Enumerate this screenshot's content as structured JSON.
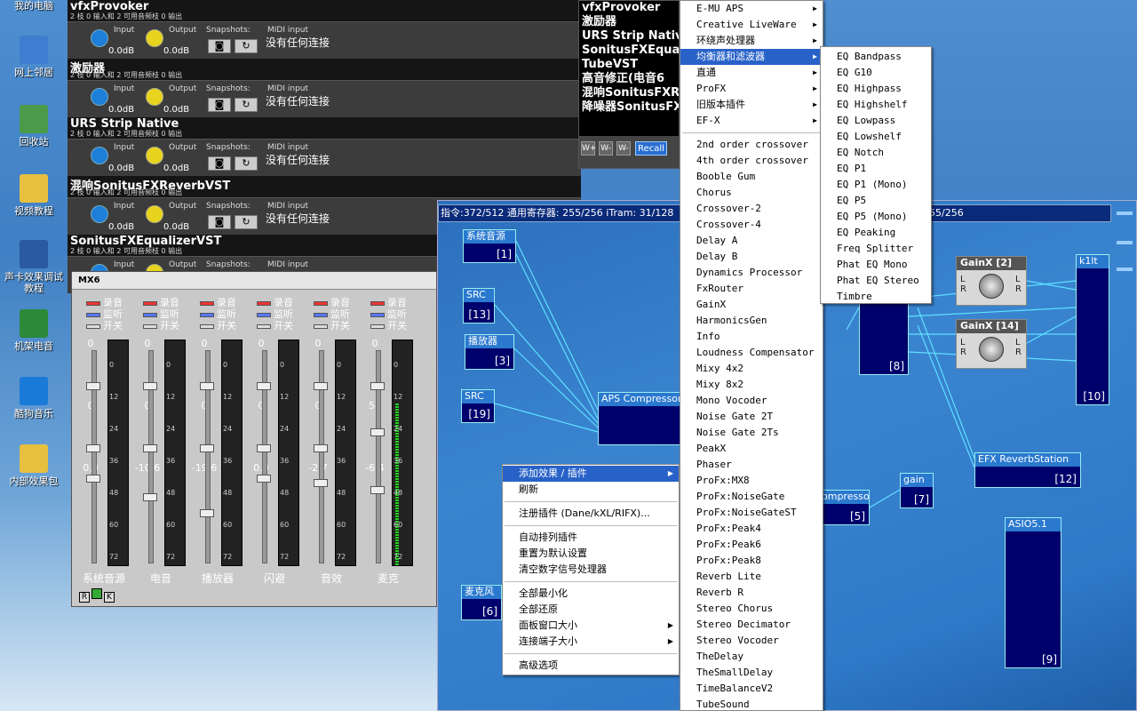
{
  "desktop": {
    "icons": [
      {
        "label": "我的电脑",
        "color": "#6a8ab5"
      },
      {
        "label": "网上邻居",
        "color": "#3e7ed0"
      },
      {
        "label": "回收站",
        "color": "#4a9a4a"
      },
      {
        "label": "视频教程",
        "color": "#e8c040"
      },
      {
        "label": "声卡效果调试教程",
        "color": "#2a5aa0"
      },
      {
        "label": "机架电音",
        "color": "#2a8a3a"
      },
      {
        "label": "酷狗音乐",
        "color": "#1a7ad8"
      },
      {
        "label": "内部效果包",
        "color": "#e8c040"
      }
    ]
  },
  "rack": {
    "plugins": [
      {
        "name": "vfxProvoker",
        "info": "2 枝 0 输入和 2 可用音频枝 0 输出",
        "input_label": "Input",
        "output_label": "Output",
        "input_val": "0.0dB",
        "output_val": "0.0dB",
        "snap_label": "Snapshots:",
        "midi_label": "MIDI input",
        "midi_status": "没有任何连接"
      },
      {
        "name": "激励器",
        "info": "2 枝 0 输入和 2 可用音频枝 0 输出",
        "input_label": "Input",
        "output_label": "Output",
        "input_val": "0.0dB",
        "output_val": "0.0dB",
        "snap_label": "Snapshots:",
        "midi_label": "MIDI input",
        "midi_status": "没有任何连接"
      },
      {
        "name": "URS Strip Native",
        "info": "2 枝 0 输入和 2 可用音频枝 0 输出",
        "input_label": "Input",
        "output_label": "Output",
        "input_val": "0.0dB",
        "output_val": "0.0dB",
        "snap_label": "Snapshots:",
        "midi_label": "MIDI input",
        "midi_status": "没有任何连接"
      },
      {
        "name": "混响SonitusFXReverbVST",
        "info": "2 枝 0 输入和 2 可用音频枝 0 输出",
        "input_label": "Input",
        "output_label": "Output",
        "input_val": "0.0dB",
        "output_val": "0.0dB",
        "snap_label": "Snapshots:",
        "midi_label": "MIDI input",
        "midi_status": "没有任何连接"
      },
      {
        "name": "SonitusFXEqualizerVST",
        "info": "2 枝 0 输入和 2 可用音频枝 0 输出",
        "input_label": "Input",
        "output_label": "Output",
        "input_val": "",
        "output_val": "",
        "snap_label": "Snapshots:",
        "midi_label": "MIDI input",
        "midi_status": ""
      }
    ]
  },
  "fxpanel": {
    "items": [
      "vfxProvoker",
      "激励器",
      "URS Strip Native",
      "SonitusFXEqualiz",
      "TubeVST",
      "高音修正(电音6",
      "混响SonitusFXR",
      "降噪器SonitusFX"
    ],
    "recall": "Recall"
  },
  "dsp": {
    "title": "指令:372/512 通用寄存器: 255/256 iTram: 31/128",
    "title_right": "55/256",
    "modules": [
      {
        "title": "系统音源",
        "num": "[1]"
      },
      {
        "title": "SRC",
        "num": "[13]"
      },
      {
        "title": "播放器",
        "num": "[3]"
      },
      {
        "title": "SRC",
        "num": "[19]"
      },
      {
        "title": "APS Compressor",
        "num": ""
      },
      {
        "title": "",
        "num": "[8]"
      },
      {
        "title": "k1lt",
        "num": "[10]"
      },
      {
        "title": "EFX ReverbStation",
        "num": "[12]"
      },
      {
        "title": "ompressor",
        "num": "[5]"
      },
      {
        "title": "gain",
        "num": "[7]"
      },
      {
        "title": "ASIO5.1",
        "num": "[9]"
      },
      {
        "title": "麦克风",
        "num": "[6]"
      }
    ],
    "gains": [
      {
        "title": "GainX [2]"
      },
      {
        "title": "GainX [14]"
      }
    ]
  },
  "mixer": {
    "title": "MX6",
    "rec": "录音",
    "mon": "监听",
    "sw": "开关",
    "channels": [
      {
        "name": "系统音源",
        "v1": "0",
        "v2": "0",
        "v3": "0.0",
        "level": 0
      },
      {
        "name": "电音",
        "v1": "0",
        "v2": "0",
        "v3": "-10.6",
        "level": 0
      },
      {
        "name": "播放器",
        "v1": "0",
        "v2": "0",
        "v3": "-19.6",
        "level": 0
      },
      {
        "name": "闪避",
        "v1": "0",
        "v2": "0",
        "v3": "0.0",
        "level": 0
      },
      {
        "name": "音效",
        "v1": "0",
        "v2": "0",
        "v3": "-2.7",
        "level": 0
      },
      {
        "name": "麦克",
        "v1": "0",
        "v2": "54",
        "v3": "-6.4",
        "level": 0.72
      }
    ],
    "scale": [
      "0",
      "12",
      "24",
      "36",
      "48",
      "60",
      "72"
    ],
    "footer": [
      "R",
      "",
      "K"
    ]
  },
  "menu1": {
    "items": [
      {
        "label": "E-MU APS",
        "sub": true
      },
      {
        "label": "Creative LiveWare",
        "sub": true
      },
      {
        "label": "环绕声处理器",
        "sub": true
      },
      {
        "label": "均衡器和滤波器",
        "sub": true,
        "sel": true
      },
      {
        "label": "直通",
        "sub": true
      },
      {
        "label": "ProFX",
        "sub": true
      },
      {
        "label": "旧版本插件",
        "sub": true
      },
      {
        "label": "EF-X",
        "sub": true
      },
      {
        "sep": true
      },
      {
        "label": "2nd order crossover"
      },
      {
        "label": "4th order crossover"
      },
      {
        "label": "Booble Gum"
      },
      {
        "label": "Chorus"
      },
      {
        "label": "Crossover-2"
      },
      {
        "label": "Crossover-4"
      },
      {
        "label": "Delay A"
      },
      {
        "label": "Delay B"
      },
      {
        "label": "Dynamics Processor"
      },
      {
        "label": "FxRouter"
      },
      {
        "label": "GainX"
      },
      {
        "label": "HarmonicsGen"
      },
      {
        "label": "Info"
      },
      {
        "label": "Loudness Compensator"
      },
      {
        "label": "Mixy 4x2"
      },
      {
        "label": "Mixy 8x2"
      },
      {
        "label": "Mono Vocoder"
      },
      {
        "label": "Noise Gate 2T"
      },
      {
        "label": "Noise Gate 2Ts"
      },
      {
        "label": "PeakX"
      },
      {
        "label": "Phaser"
      },
      {
        "label": "ProFx:MX8"
      },
      {
        "label": "ProFx:NoiseGate"
      },
      {
        "label": "ProFx:NoiseGateST"
      },
      {
        "label": "ProFx:Peak4"
      },
      {
        "label": "ProFx:Peak6"
      },
      {
        "label": "ProFx:Peak8"
      },
      {
        "label": "Reverb Lite"
      },
      {
        "label": "Reverb R"
      },
      {
        "label": "Stereo Chorus"
      },
      {
        "label": "Stereo Decimator"
      },
      {
        "label": "Stereo Vocoder"
      },
      {
        "label": "TheDelay"
      },
      {
        "label": "TheSmallDelay"
      },
      {
        "label": "TimeBalanceV2"
      },
      {
        "label": "TubeSound"
      }
    ]
  },
  "menu2": {
    "items": [
      "EQ Bandpass",
      "EQ G10",
      "EQ Highpass",
      "EQ Highshelf",
      "EQ Lowpass",
      "EQ Lowshelf",
      "EQ Notch",
      "EQ P1",
      "EQ P1 (Mono)",
      "EQ P5",
      "EQ P5 (Mono)",
      "EQ Peaking",
      "Freq Splitter",
      "Phat EQ Mono",
      "Phat EQ Stereo",
      "Timbre"
    ]
  },
  "ctx": {
    "items": [
      {
        "label": "添加效果 / 插件",
        "sub": true,
        "sel": true
      },
      {
        "label": "刷新"
      },
      {
        "sep": true
      },
      {
        "label": "注册插件 (Dane/kXL/RIFX)..."
      },
      {
        "sep": true
      },
      {
        "label": "自动排列插件"
      },
      {
        "label": "重置为默认设置"
      },
      {
        "label": "清空数字信号处理器"
      },
      {
        "sep": true
      },
      {
        "label": "全部最小化"
      },
      {
        "label": "全部还原"
      },
      {
        "label": "面板窗口大小",
        "sub": true
      },
      {
        "label": "连接端子大小",
        "sub": true
      },
      {
        "sep": true
      },
      {
        "label": "高级选项"
      }
    ]
  }
}
